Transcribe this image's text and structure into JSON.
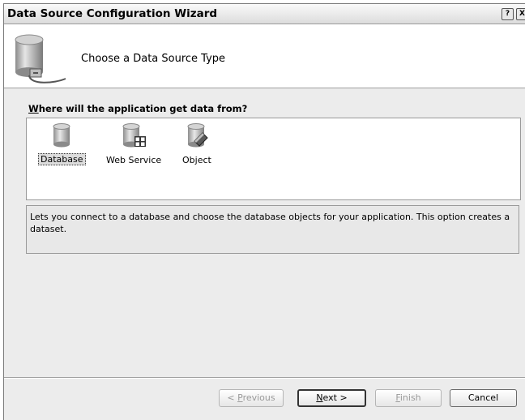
{
  "window": {
    "title": "Data Source Configuration Wizard",
    "help_glyph": "?",
    "close_glyph": "X"
  },
  "header": {
    "title": "Choose a Data Source Type",
    "icon": "database-plug-icon"
  },
  "prompt": {
    "accel": "W",
    "rest": "here will the application get data from?"
  },
  "sources": [
    {
      "label": "Database",
      "icon": "database-icon",
      "selected": true
    },
    {
      "label": "Web Service",
      "icon": "web-service-icon",
      "selected": false
    },
    {
      "label": "Object",
      "icon": "object-icon",
      "selected": false
    }
  ],
  "description": "Lets you connect to a database and choose the database objects for your application. This option creates a dataset.",
  "buttons": {
    "previous": {
      "pre": "< ",
      "accel": "P",
      "rest": "revious",
      "enabled": false
    },
    "next": {
      "accel": "N",
      "rest": "ext >",
      "enabled": true
    },
    "finish": {
      "accel": "F",
      "rest": "inish",
      "enabled": false
    },
    "cancel": {
      "label": "Cancel",
      "enabled": true
    }
  },
  "colors": {
    "dialog_bg": "#ececec",
    "header_bg": "#ffffff",
    "disabled_text": "#9a9a9a"
  }
}
